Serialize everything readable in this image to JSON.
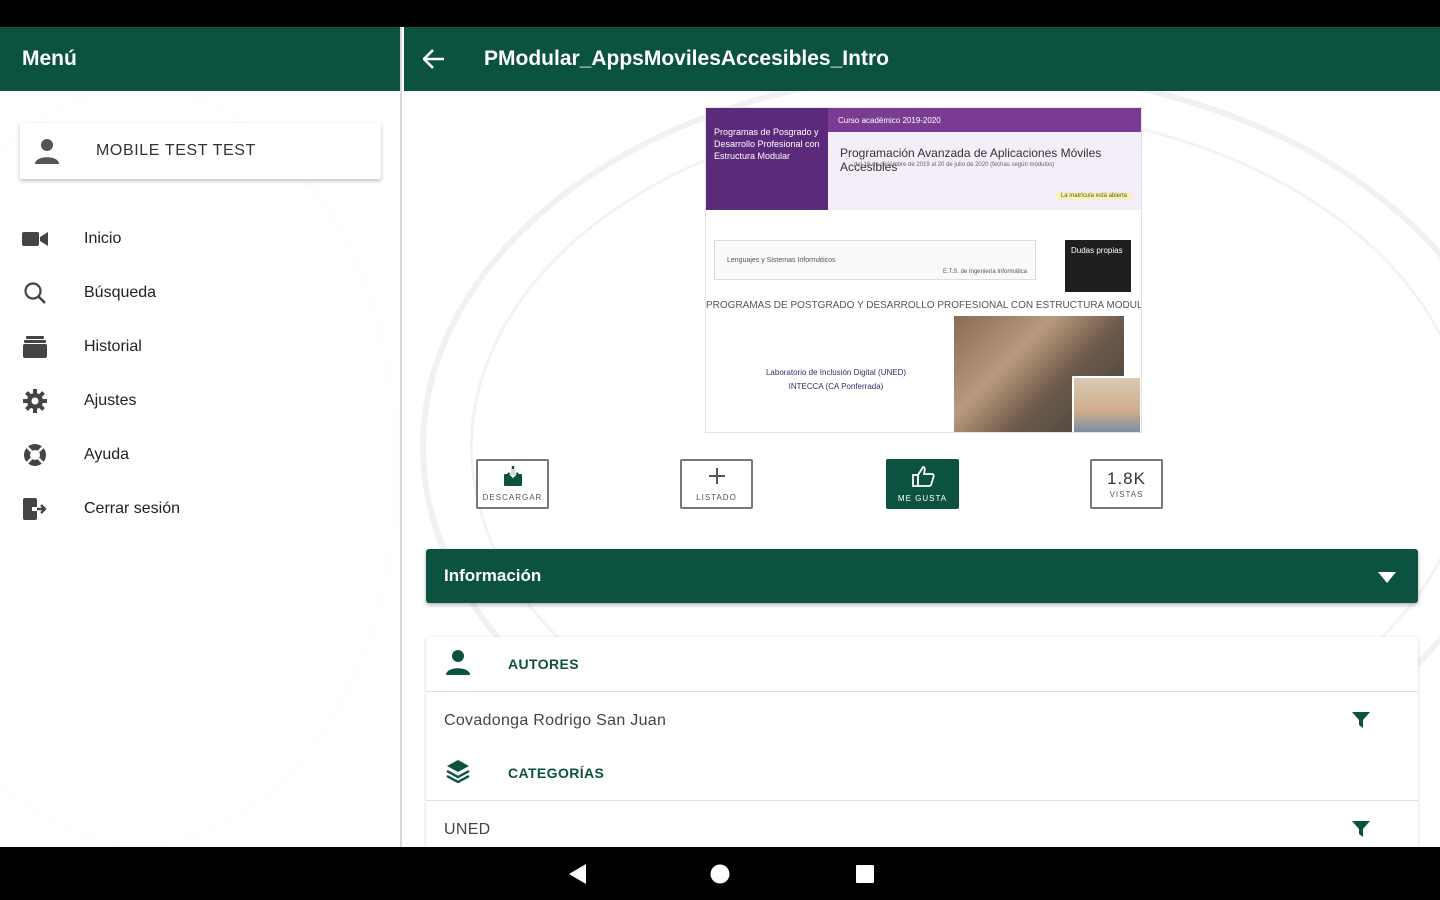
{
  "drawer": {
    "title": "Menú",
    "user_name": "MOBILE TEST TEST",
    "items": [
      {
        "label": "Inicio",
        "icon": "video-camera-icon"
      },
      {
        "label": "Búsqueda",
        "icon": "search-icon"
      },
      {
        "label": "Historial",
        "icon": "history-box-icon"
      },
      {
        "label": "Ajustes",
        "icon": "gear-icon"
      },
      {
        "label": "Ayuda",
        "icon": "lifebuoy-icon"
      },
      {
        "label": "Cerrar sesión",
        "icon": "logout-icon"
      }
    ]
  },
  "appbar": {
    "title": "PModular_AppsMovilesAccesibles_Intro",
    "back_icon": "arrow-back-icon"
  },
  "thumbnail": {
    "banner_left": "Programas de Posgrado y Desarrollo Profesional con Estructura Modular",
    "banner_top": "Curso académico 2019-2020",
    "course_title": "Programación Avanzada de Aplicaciones Móviles Accesibles",
    "dates": "del 16 de diciembre de 2019 al 20 de julio de 2020 (fechas según módulos)",
    "tag": "La matrícula está abierta",
    "field_label": "Lenguajes y Sistemas Informáticos",
    "field_right": "E.T.S. de Ingeniería Informática",
    "cover_text": "Dudas propias",
    "heading": "PROGRAMAS DE POSTGRADO Y DESARROLLO PROFESIONAL CON ESTRUCTURA MODULAR",
    "lab_line1": "Laboratorio de Inclusión Digital (UNED)",
    "lab_line2": "INTECCA (CA Ponferrada)"
  },
  "actions": {
    "download": "DESCARGAR",
    "lists": "LISTADO",
    "like": "ME GUSTA",
    "views_value": "1.8K",
    "views_label": "VISTAS"
  },
  "info": {
    "title": "Información",
    "authors_label": "AUTORES",
    "author": "Covadonga Rodrigo San Juan",
    "categories_label": "CATEGORÍAS",
    "category": "UNED"
  },
  "colors": {
    "primary": "#0b5340",
    "text": "#222222"
  }
}
